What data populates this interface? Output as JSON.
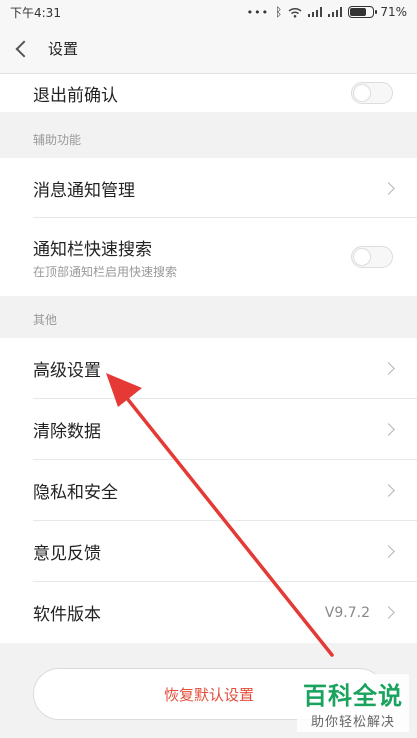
{
  "status_bar": {
    "time": "下午4:31",
    "dots": "•••",
    "battery_text": "71%",
    "battery_level": 0.71
  },
  "nav": {
    "title": "设置"
  },
  "rows": {
    "exit_confirm": {
      "label": "退出前确认"
    },
    "notification": {
      "label": "消息通知管理"
    },
    "quick_search": {
      "label": "通知栏快速搜索",
      "sub": "在顶部通知栏启用快速搜索"
    },
    "advanced": {
      "label": "高级设置"
    },
    "clear_data": {
      "label": "清除数据"
    },
    "privacy": {
      "label": "隐私和安全"
    },
    "feedback": {
      "label": "意见反馈"
    },
    "version": {
      "label": "软件版本",
      "value": "V9.7.2"
    }
  },
  "sections": {
    "accessibility": "辅助功能",
    "other": "其他"
  },
  "reset_button": {
    "label": "恢复默认设置"
  },
  "watermark": {
    "title": "百科全说",
    "subtitle": "助你轻松解决"
  },
  "colors": {
    "accent_red": "#e34f3b",
    "arrow_red": "#e53935",
    "watermark_green": "#1aa35e"
  }
}
